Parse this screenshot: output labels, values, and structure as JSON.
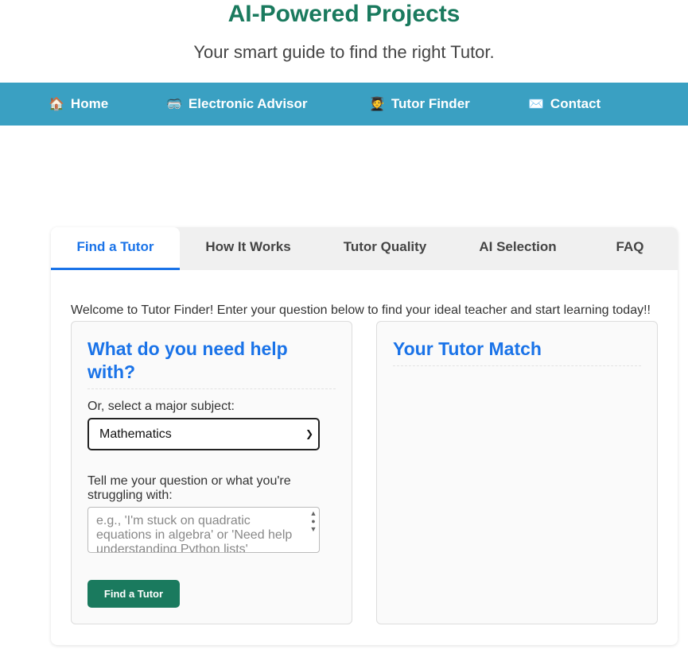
{
  "header": {
    "title": "AI-Powered Projects",
    "subtitle": "Your smart guide to find the right Tutor."
  },
  "nav": {
    "items": [
      {
        "icon": "🏠",
        "label": "Home"
      },
      {
        "icon": "🥽",
        "label": "Electronic Advisor"
      },
      {
        "icon": "🧑‍🎓",
        "label": "Tutor Finder"
      },
      {
        "icon": "✉️",
        "label": "Contact"
      }
    ]
  },
  "tabs": {
    "items": [
      {
        "label": "Find a Tutor",
        "active": true
      },
      {
        "label": "How It Works",
        "active": false
      },
      {
        "label": "Tutor Quality",
        "active": false
      },
      {
        "label": "AI Selection",
        "active": false
      },
      {
        "label": "FAQ",
        "active": false
      }
    ]
  },
  "main": {
    "welcome": "Welcome to Tutor Finder! Enter your question below to find your ideal teacher and start learning today!!"
  },
  "help_form": {
    "title": "What do you need help with?",
    "subject_label": "Or, select a major subject:",
    "subject_selected": "Mathematics",
    "question_label": "Tell me your question or what you're struggling with:",
    "question_placeholder": "e.g., 'I'm stuck on quadratic equations in algebra' or 'Need help understanding Python lists'",
    "submit_label": "Find a Tutor"
  },
  "match": {
    "title": "Your Tutor Match"
  },
  "colors": {
    "brand_green": "#1a7a5e",
    "nav_blue": "#3aa0c2",
    "accent_blue": "#1a73e8"
  }
}
